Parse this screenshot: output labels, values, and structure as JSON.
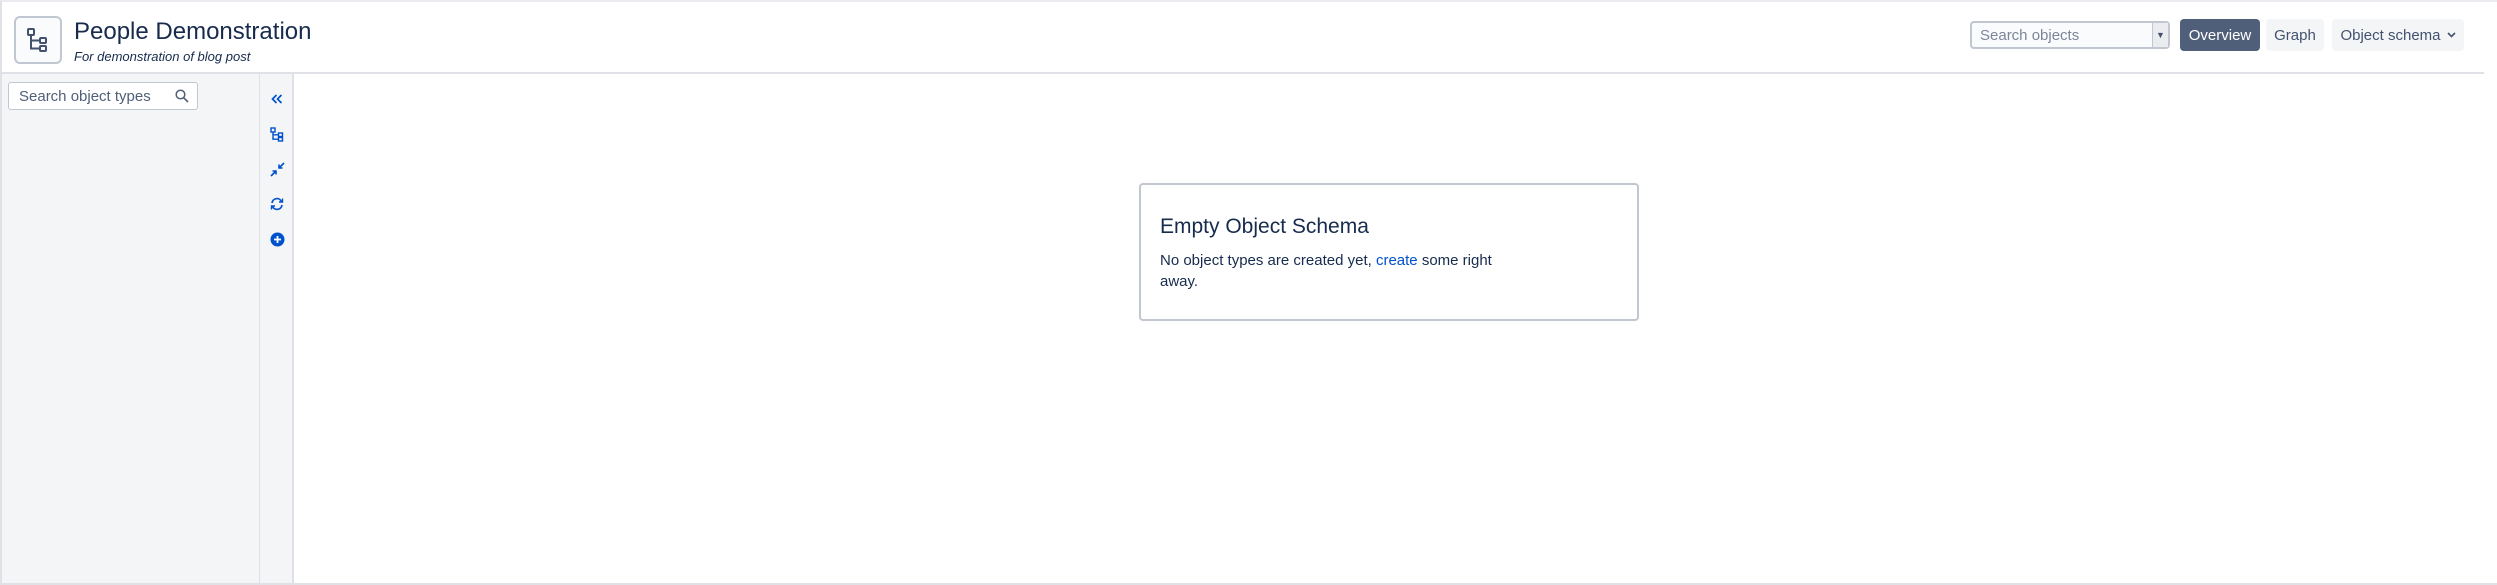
{
  "header": {
    "schema_icon": "hierarchy-icon",
    "title": "People Demonstration",
    "subtitle": "For demonstration of blog post",
    "search_placeholder": "Search objects",
    "overview_label": "Overview",
    "graph_label": "Graph",
    "object_schema_label": "Object schema"
  },
  "sidebar": {
    "search_placeholder": "Search object types",
    "search_icon": "search-icon"
  },
  "toolbar": {
    "tools": [
      "collapse-sidebar-icon",
      "hierarchy-view-icon",
      "collapse-all-icon",
      "refresh-icon",
      "add-object-type-icon"
    ]
  },
  "empty_state": {
    "title": "Empty Object Schema",
    "text_before": "No object types are created yet, ",
    "link": "create",
    "text_after": " some right away."
  },
  "colors": {
    "primary_button": "#505f79",
    "link": "#0052cc",
    "icon_blue": "#0052cc",
    "sidebar_bg": "#f4f5f7"
  }
}
